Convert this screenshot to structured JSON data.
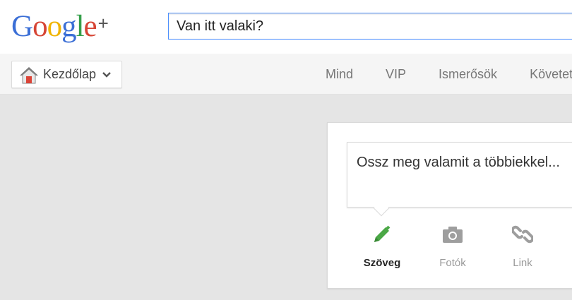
{
  "header": {
    "logo_text": "Google",
    "logo_plus": "+",
    "search_value": "Van itt valaki?"
  },
  "nav": {
    "home_label": "Kezdőlap",
    "tabs": [
      {
        "label": "Mind",
        "active": true
      },
      {
        "label": "VIP",
        "active": false
      },
      {
        "label": "Ismerősök",
        "active": false
      },
      {
        "label": "Követett",
        "active": false
      }
    ]
  },
  "share": {
    "placeholder": "Ossz meg valamit a többiekkel...",
    "actions": [
      {
        "label": "Szöveg",
        "icon": "pencil-icon",
        "active": true
      },
      {
        "label": "Fotók",
        "icon": "camera-icon",
        "active": false
      },
      {
        "label": "Link",
        "icon": "link-icon",
        "active": false
      }
    ]
  },
  "colors": {
    "accent_blue": "#427fed",
    "pencil_green": "#4ba846",
    "home_red": "#db4437",
    "background": "#e5e5e5"
  }
}
